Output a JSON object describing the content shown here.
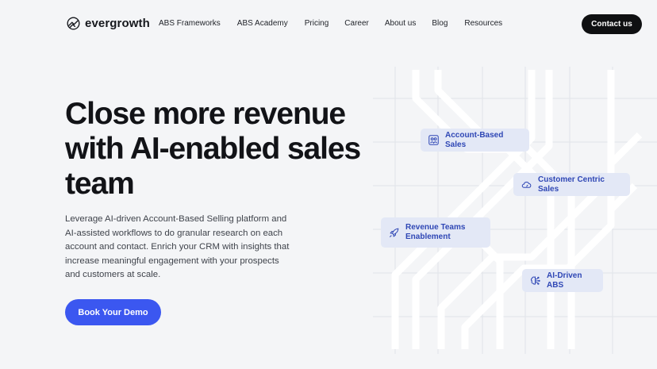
{
  "brand": {
    "name": "evergrowth"
  },
  "nav": {
    "items": [
      "ABS Frameworks",
      "ABS Academy",
      "Pricing",
      "Career",
      "About us",
      "Blog",
      "Resources"
    ],
    "cta": "Contact us"
  },
  "hero": {
    "title": "Close more revenue with AI-enabled sales team",
    "description": "Leverage AI-driven Account-Based Selling platform and AI-assisted workflows to do granular research on each account and contact. Enrich your CRM with insights that increase meaningful engagement with your prospects and customers at scale.",
    "cta": "Book Your Demo"
  },
  "graphic": {
    "tags": [
      {
        "label": "Account-Based Sales",
        "icon": "people-icon"
      },
      {
        "label": "Customer Centric Sales",
        "icon": "cloud-icon"
      },
      {
        "label": "Revenue Teams Enablement",
        "icon": "rocket-icon"
      },
      {
        "label": "AI-Driven ABS",
        "icon": "brain-icon"
      }
    ]
  },
  "colors": {
    "accent": "#3b57f0",
    "dark": "#0f1012",
    "tag_bg": "#e3e8f6",
    "tag_text": "#2f47b5"
  }
}
